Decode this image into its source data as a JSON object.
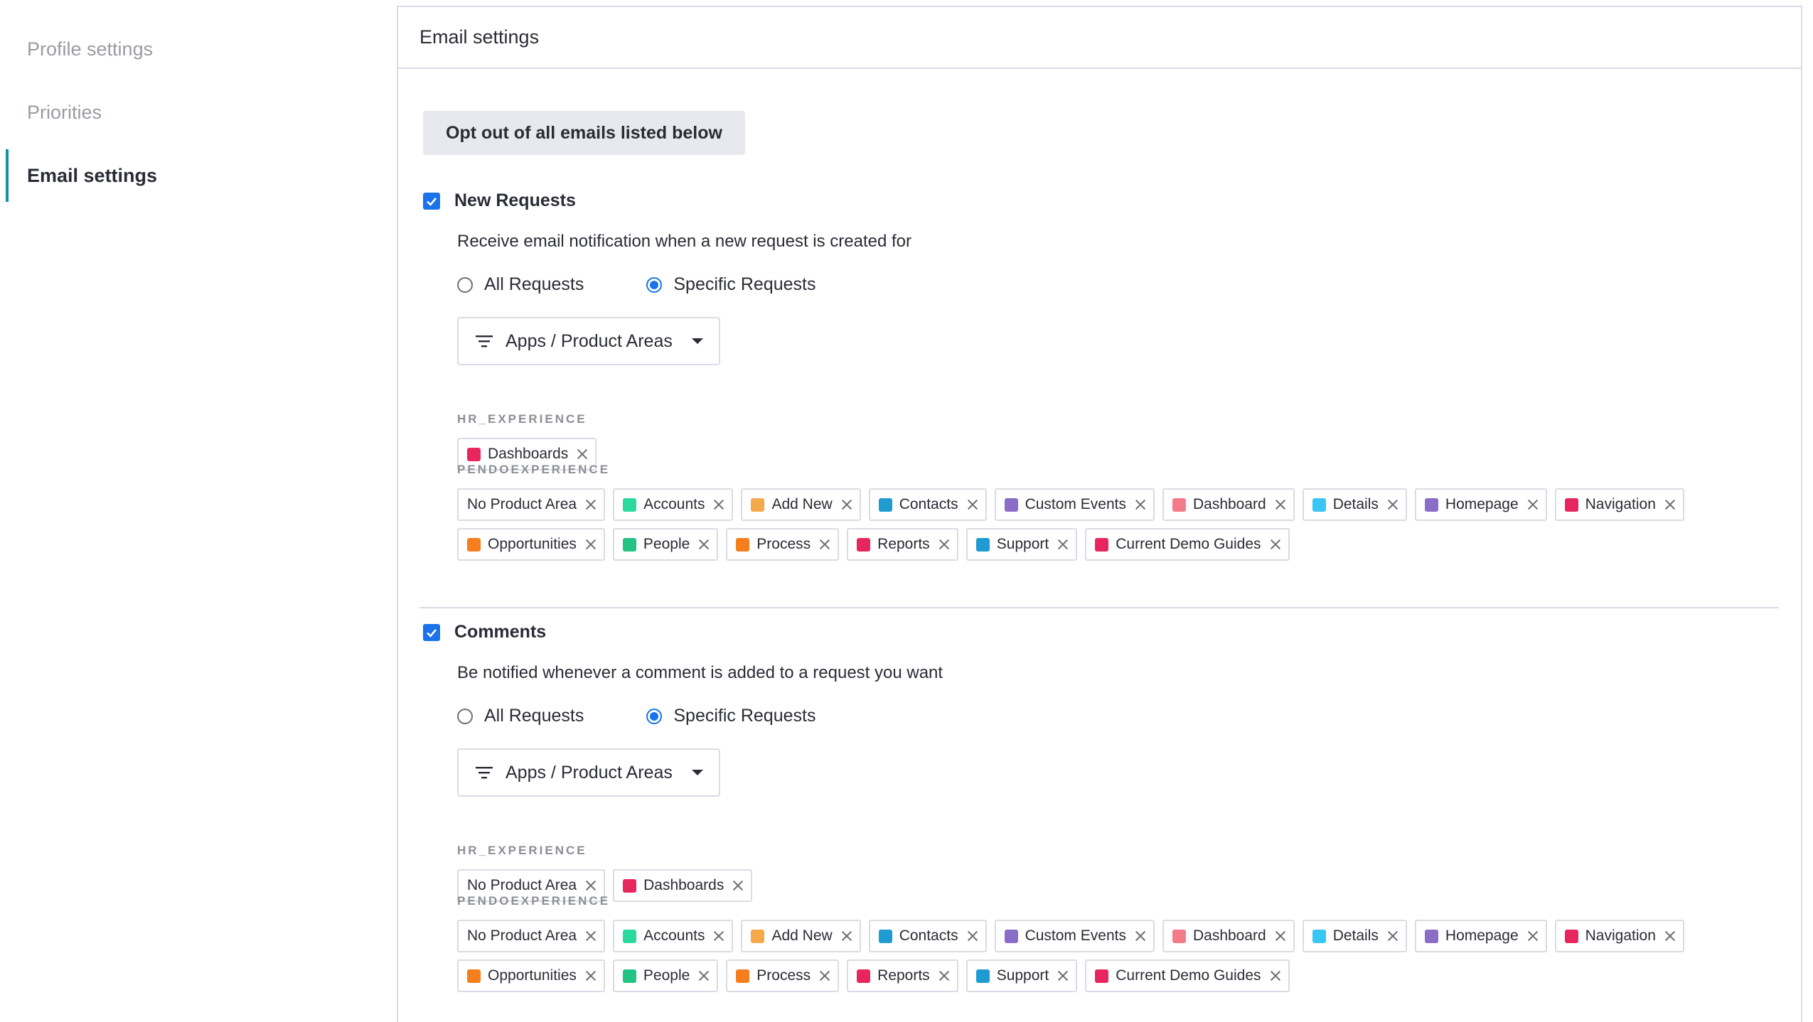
{
  "sidebar": {
    "items": [
      {
        "label": "Profile settings"
      },
      {
        "label": "Priorities"
      },
      {
        "label": "Email settings",
        "active": true
      }
    ]
  },
  "panel": {
    "title": "Email settings",
    "opt_out_label": "Opt out of all emails listed below"
  },
  "sections": [
    {
      "title": "New Requests",
      "checked": true,
      "description": "Receive email notification when a new request is created for",
      "radio_all": "All Requests",
      "radio_specific": "Specific Requests",
      "selected": "specific",
      "dropdown_label": "Apps / Product Areas",
      "groups": [
        {
          "label": "HR_EXPERIENCE",
          "chips": [
            {
              "label": "Dashboards",
              "color": "#e8265e"
            }
          ]
        },
        {
          "label": "PENDOEXPERIENCE",
          "chips_row1": [
            {
              "label": "No Product Area",
              "color": null
            },
            {
              "label": "Accounts",
              "color": "#2bd99f"
            },
            {
              "label": "Add New",
              "color": "#f5a94b"
            },
            {
              "label": "Contacts",
              "color": "#1f9bd1"
            },
            {
              "label": "Custom Events",
              "color": "#8a6dc7"
            },
            {
              "label": "Dashboard",
              "color": "#f47c8a"
            },
            {
              "label": "Details",
              "color": "#38c6f4"
            },
            {
              "label": "Homepage",
              "color": "#8a6dc7"
            },
            {
              "label": "Navigation",
              "color": "#e8265e"
            }
          ],
          "chips_row2": [
            {
              "label": "Opportunities",
              "color": "#f57e1f"
            },
            {
              "label": "People",
              "color": "#22c384"
            },
            {
              "label": "Process",
              "color": "#f57e1f"
            },
            {
              "label": "Reports",
              "color": "#e8265e"
            },
            {
              "label": "Support",
              "color": "#1f9bd1"
            },
            {
              "label": "Current Demo Guides",
              "color": "#e8265e"
            }
          ]
        }
      ]
    },
    {
      "title": "Comments",
      "checked": true,
      "description": "Be notified whenever a comment is added to a request you want",
      "radio_all": "All Requests",
      "radio_specific": "Specific Requests",
      "selected": "specific",
      "dropdown_label": "Apps / Product Areas",
      "groups": [
        {
          "label": "HR_EXPERIENCE",
          "chips": [
            {
              "label": "No Product Area",
              "color": null
            },
            {
              "label": "Dashboards",
              "color": "#e8265e"
            }
          ]
        },
        {
          "label": "PENDOEXPERIENCE",
          "chips_row1": [
            {
              "label": "No Product Area",
              "color": null
            },
            {
              "label": "Accounts",
              "color": "#2bd99f"
            },
            {
              "label": "Add New",
              "color": "#f5a94b"
            },
            {
              "label": "Contacts",
              "color": "#1f9bd1"
            },
            {
              "label": "Custom Events",
              "color": "#8a6dc7"
            },
            {
              "label": "Dashboard",
              "color": "#f47c8a"
            },
            {
              "label": "Details",
              "color": "#38c6f4"
            },
            {
              "label": "Homepage",
              "color": "#8a6dc7"
            },
            {
              "label": "Navigation",
              "color": "#e8265e"
            }
          ],
          "chips_row2": [
            {
              "label": "Opportunities",
              "color": "#f57e1f"
            },
            {
              "label": "People",
              "color": "#22c384"
            },
            {
              "label": "Process",
              "color": "#f57e1f"
            },
            {
              "label": "Reports",
              "color": "#e8265e"
            },
            {
              "label": "Support",
              "color": "#1f9bd1"
            },
            {
              "label": "Current Demo Guides",
              "color": "#e8265e"
            }
          ]
        }
      ]
    }
  ]
}
